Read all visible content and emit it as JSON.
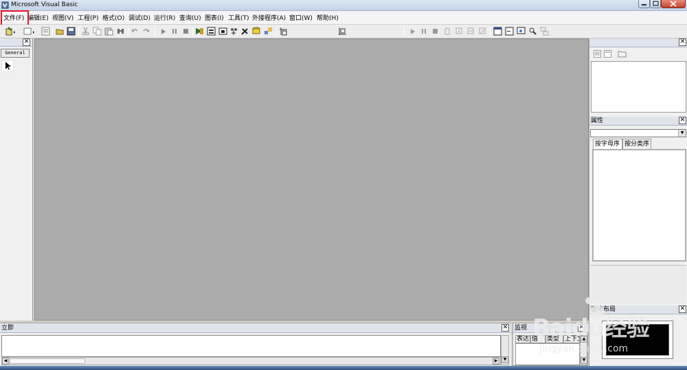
{
  "window": {
    "title": "Microsoft Visual Basic"
  },
  "menu": [
    "文件(F)",
    "编辑(E)",
    "视图(V)",
    "工程(P)",
    "格式(O)",
    "调试(D)",
    "运行(R)",
    "查询(U)",
    "图表(I)",
    "工具(T)",
    "外接程序(A)",
    "窗口(W)",
    "帮助(H)"
  ],
  "toolbox": {
    "tab_label": "General"
  },
  "properties": {
    "title": "属性",
    "tabs": [
      "按字母序",
      "按分类序"
    ]
  },
  "layout_window": {
    "title": "窗体布局"
  },
  "immediate": {
    "title": "立即"
  },
  "watch": {
    "title": "监视",
    "columns": [
      "表达式",
      "值",
      "类型",
      "上下文"
    ]
  },
  "watermark": {
    "brand": "Baidu经验",
    "url": "jingyan.baidu.com"
  },
  "colors": {
    "mdi_background": "#ababab",
    "highlight": "#e8122b"
  }
}
